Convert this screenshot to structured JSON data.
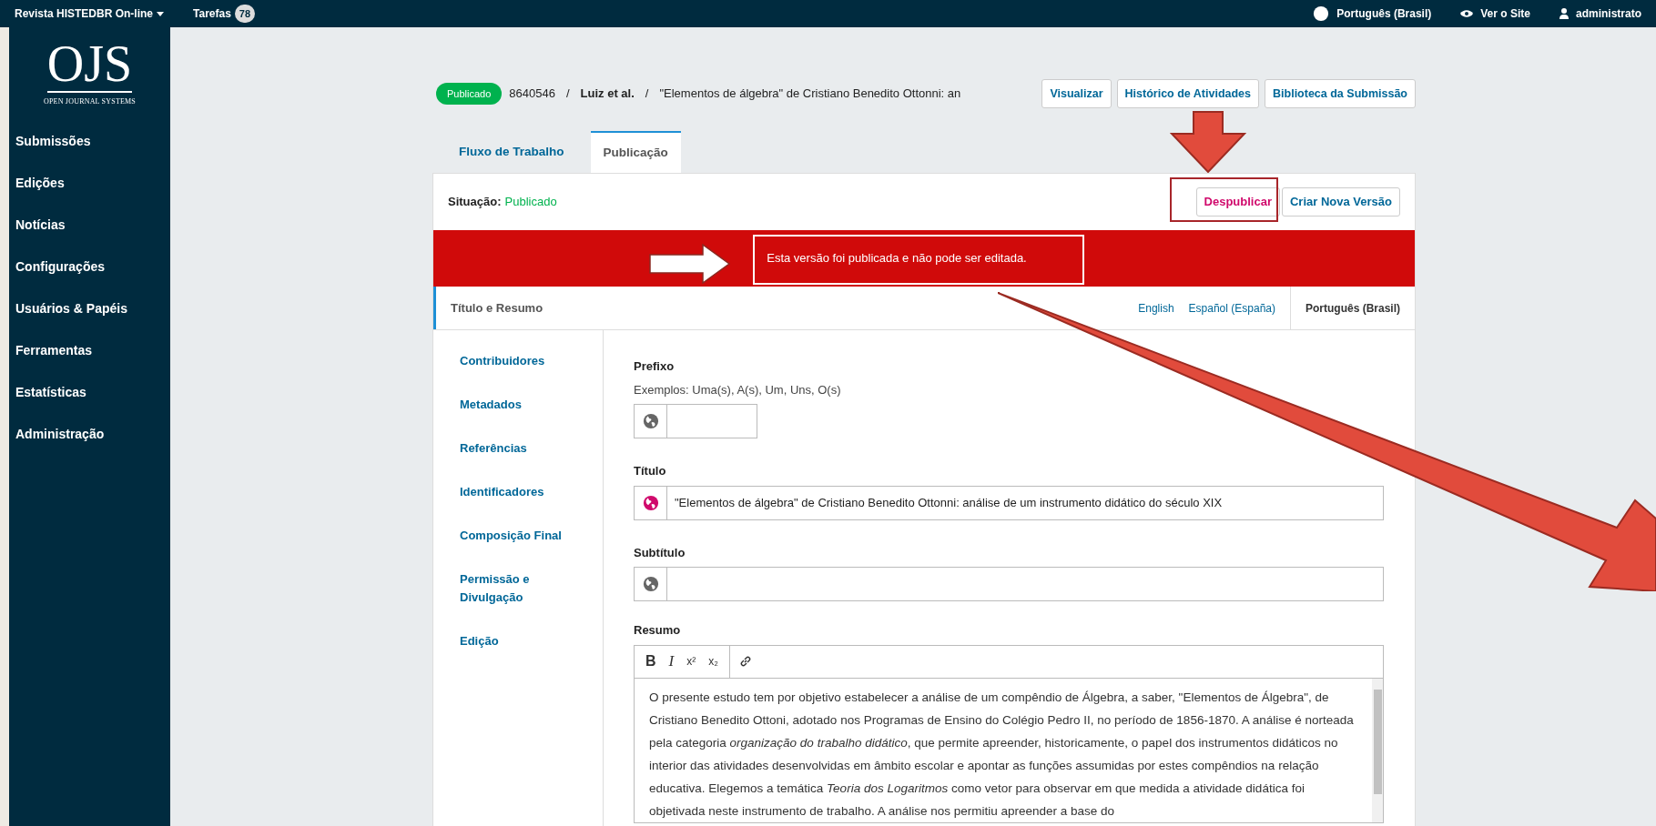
{
  "top_bar": {
    "journal": "Revista HISTEDBR On-line",
    "tasks": {
      "label": "Tarefas",
      "count": "78"
    },
    "right_items": [
      {
        "kind": "globe",
        "label": "Português (Brasil)"
      },
      {
        "kind": "eye",
        "label": "Ver o Site"
      },
      {
        "kind": "user",
        "label": "administrato"
      }
    ]
  },
  "logo": {
    "letters": "OJS",
    "subtitle": "OPEN JOURNAL SYSTEMS"
  },
  "sidebar": {
    "items": [
      {
        "label": "Submissões"
      },
      {
        "label": "Edições"
      },
      {
        "label": "Notícias"
      },
      {
        "label": "Configurações"
      },
      {
        "label": "Usuários & Papéis"
      },
      {
        "label": "Ferramentas"
      },
      {
        "label": "Estatísticas"
      },
      {
        "label": "Administração"
      }
    ]
  },
  "header": {
    "status_badge": "Publicado",
    "id": "8640546",
    "separator": "/",
    "authors": "Luiz et al.",
    "title": "\"Elementos de álgebra\" de Cristiano Benedito Ottonni: an",
    "buttons": [
      "Visualizar",
      "Histórico de Atividades",
      "Biblioteca da Submissão"
    ]
  },
  "tabs": [
    {
      "label": "Fluxo de Trabalho",
      "selected": false
    },
    {
      "label": "Publicação",
      "selected": true
    }
  ],
  "publication": {
    "status_label": "Situação:",
    "status_value": "Publicado",
    "actions": [
      {
        "label": "Despublicar",
        "kind": "danger"
      },
      {
        "label": "Criar Nova Versão",
        "kind": "normal"
      }
    ],
    "alert": "Esta versão foi publicada e não pode ser editada."
  },
  "nav": [
    {
      "label": "Título e Resumo",
      "selected": true
    },
    {
      "label": "Contribuidores",
      "selected": false
    },
    {
      "label": "Metadados",
      "selected": false
    },
    {
      "label": "Referências",
      "selected": false
    },
    {
      "label": "Identificadores",
      "selected": false
    },
    {
      "label": "Composição Final",
      "selected": false
    },
    {
      "label": "Permissão e Divulgação",
      "selected": false
    },
    {
      "label": "Edição",
      "selected": false
    }
  ],
  "locales": [
    {
      "label": "English",
      "selected": false
    },
    {
      "label": "Español (España)",
      "selected": false
    },
    {
      "label": "Português (Brasil)",
      "selected": true
    }
  ],
  "fields": [
    {
      "label": "Prefixo",
      "description": "Exemplos: Uma(s), A(s), Um, Uns, O(s)",
      "filled": false,
      "kind": "short"
    },
    {
      "label": "Título",
      "value": "\"Elementos de álgebra\" de Cristiano Benedito Ottonni: análise de um instrumento didático do século XIX",
      "filled": true,
      "kind": "wide"
    },
    {
      "label": "Subtítulo",
      "filled": false,
      "kind": "wide"
    }
  ],
  "abstract": {
    "label": "Resumo",
    "toolbar": [
      "B",
      "I",
      "x²",
      "x₂"
    ],
    "text": "O presente estudo tem por objetivo estabelecer a análise de um compêndio de Álgebra, a saber, \"Elementos de Álgebra\", de Cristiano Benedito Ottoni, adotado nos Programas de Ensino do Colégio Pedro II, no período de 1856-1870. A análise é norteada pela categoria *organização do trabalho didático*, que permite apreender, historicamente, o papel dos instrumentos didáticos no interior das atividades desenvolvidas em âmbito escolar e apontar as funções assumidas por estes compêndios na relação educativa. Elegemos a temática *Teoria dos Logaritmos* como vetor para observar em que medida a atividade didática foi objetivada neste instrumento de trabalho. A análise nos permitiu apreender a base do"
  }
}
